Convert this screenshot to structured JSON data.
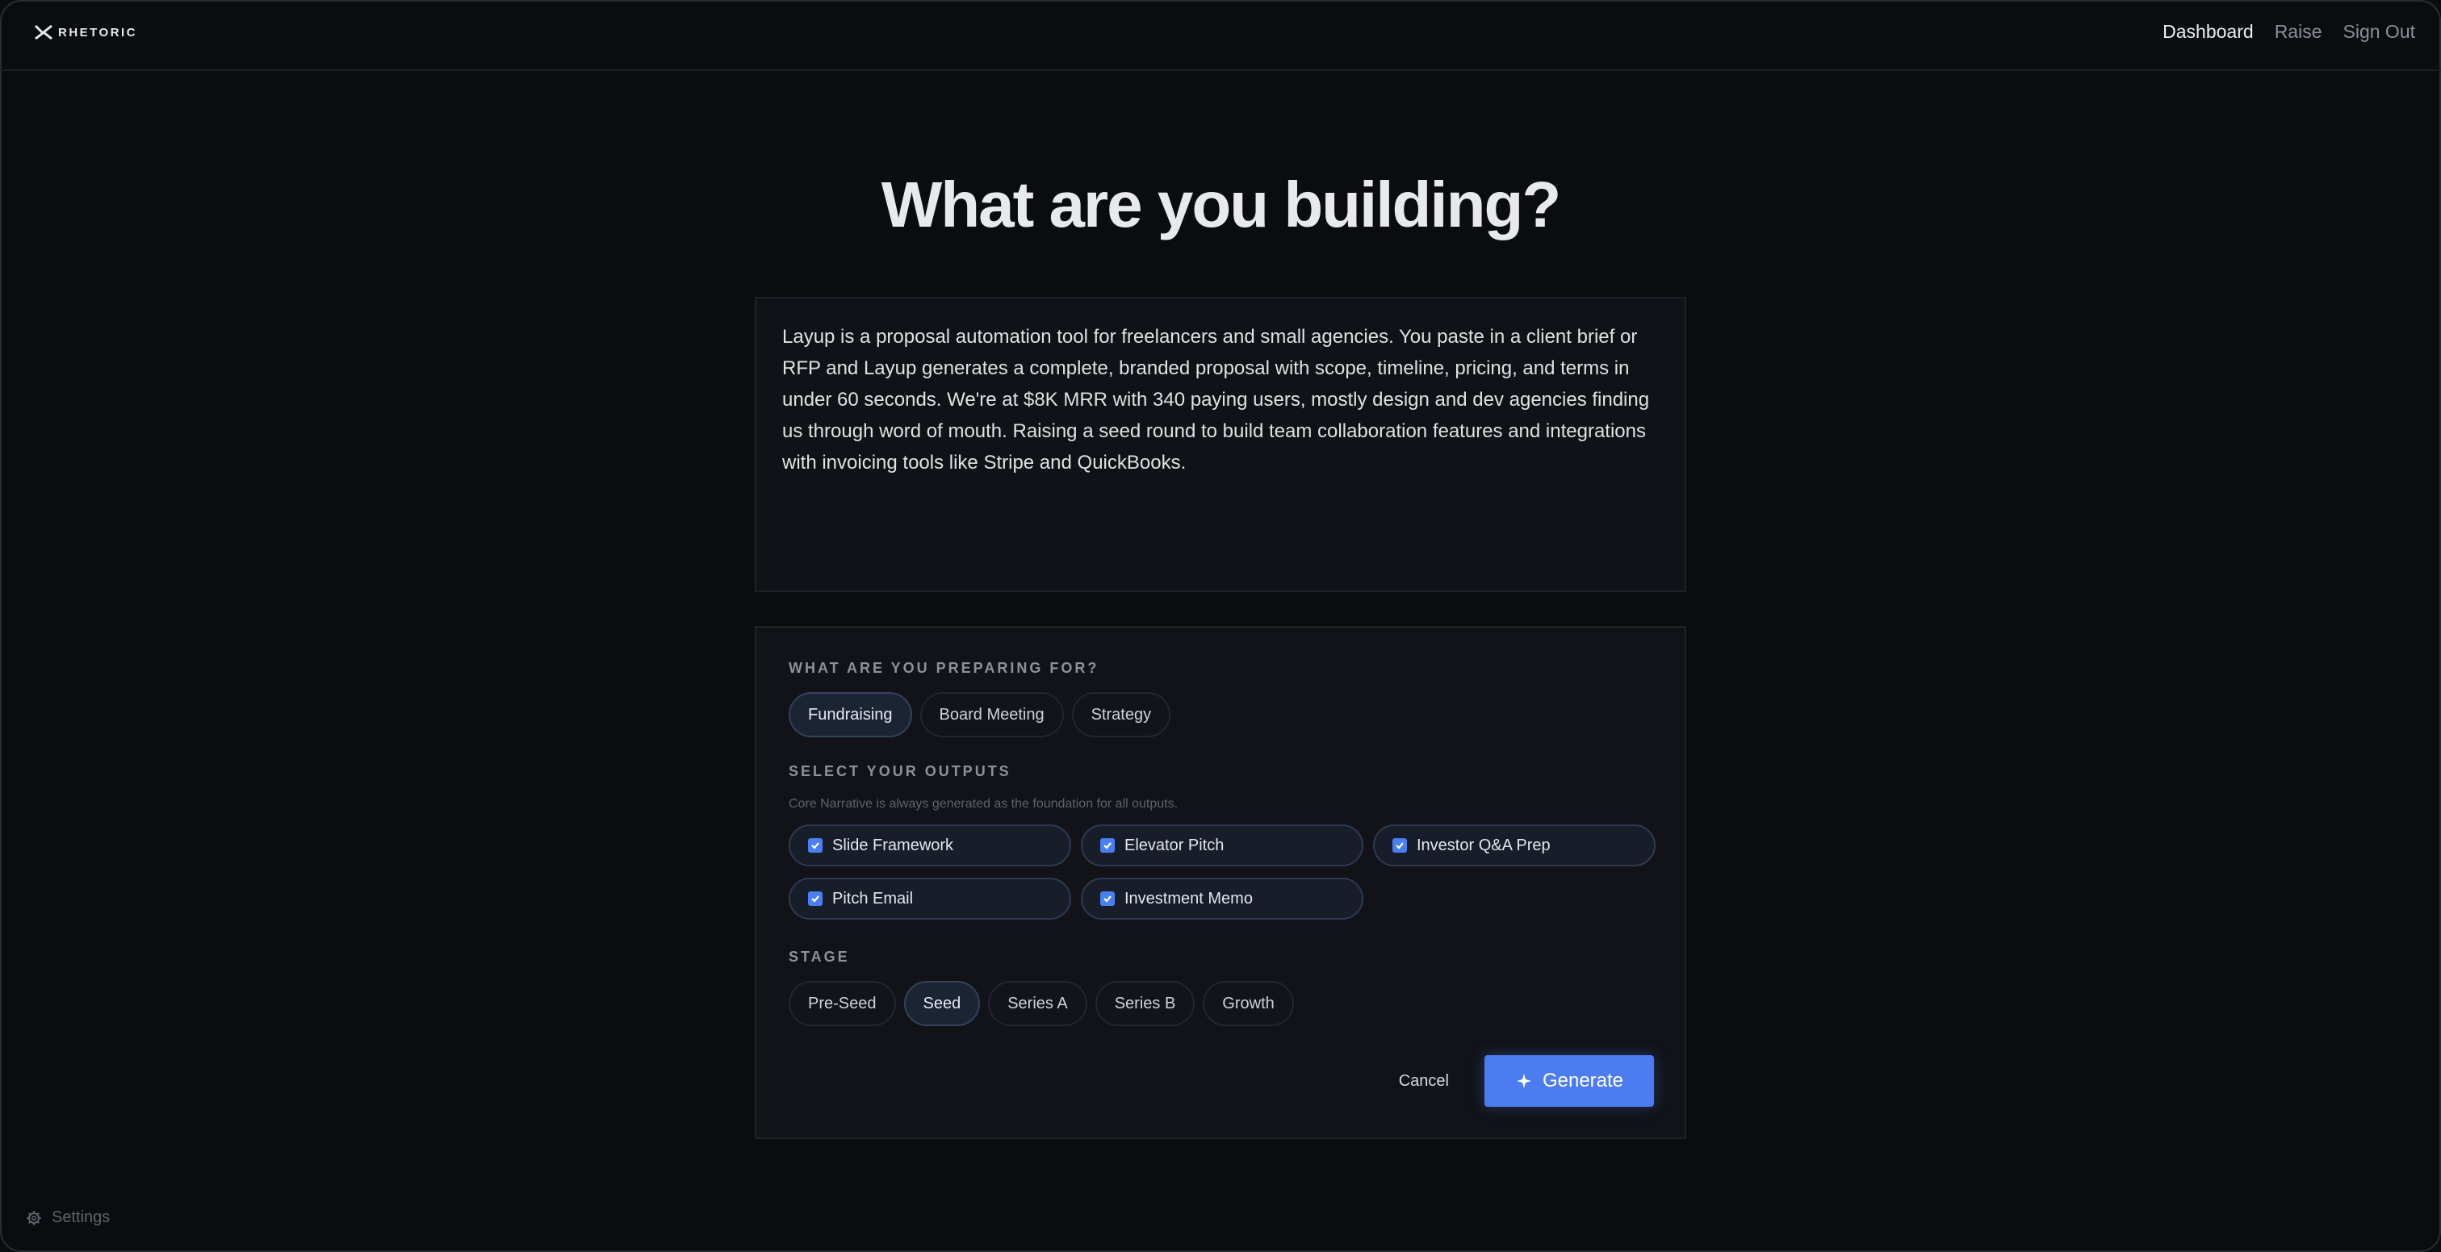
{
  "app": {
    "logo_text": "RHETORIC"
  },
  "nav": {
    "items": [
      "Dashboard",
      "Raise",
      "Sign Out"
    ]
  },
  "page": {
    "title": "What are you building?"
  },
  "description": {
    "value": "Layup is a proposal automation tool for freelancers and small agencies. You paste in a client brief or RFP and Layup generates a complete, branded proposal with scope, timeline, pricing, and terms in under 60 seconds. We're at $8K MRR with 340 paying users, mostly design and dev agencies finding us through word of mouth. Raising a seed round to build team collaboration features and integrations with invoicing tools like Stripe and QuickBooks."
  },
  "purpose": {
    "label": "WHAT ARE YOU PREPARING FOR?",
    "options": [
      "Fundraising",
      "Board Meeting",
      "Strategy"
    ],
    "selected": "Fundraising"
  },
  "outputs": {
    "label": "SELECT YOUR OUTPUTS",
    "hint": "Core Narrative is always generated as the foundation for all outputs.",
    "items": [
      "Slide Framework",
      "Elevator Pitch",
      "Investor Q&A Prep",
      "Pitch Email",
      "Investment Memo"
    ]
  },
  "stage": {
    "label": "STAGE",
    "options": [
      "Pre-Seed",
      "Seed",
      "Series A",
      "Series B",
      "Growth"
    ],
    "selected": "Seed"
  },
  "actions": {
    "cancel": "Cancel",
    "generate": "Generate"
  },
  "footer": {
    "settings": "Settings"
  },
  "colors": {
    "accent": "#4d7cf0",
    "background": "#0b0c0f"
  }
}
